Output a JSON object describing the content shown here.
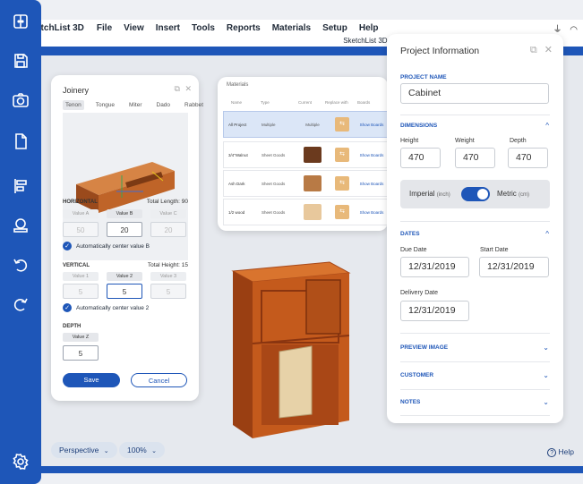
{
  "menubar": {
    "app_name": "etchList 3D",
    "items": [
      "File",
      "View",
      "Insert",
      "Tools",
      "Reports",
      "Materials",
      "Setup",
      "Help"
    ],
    "window_title": "SketchList 3D Li"
  },
  "sidebar": {
    "icons": [
      "layout-icon",
      "save-icon",
      "camera-icon",
      "copy-icon",
      "align-icon",
      "wrap-icon",
      "undo-icon",
      "redo-icon",
      "settings-icon"
    ]
  },
  "joinery": {
    "title": "Joinery",
    "tabs": [
      "Tenon",
      "Tongue",
      "Miter",
      "Dado",
      "Rabbet"
    ],
    "horizontal_label": "HORIZONTAL",
    "horizontal_total": "Total Length: 90",
    "horizontal_value_labels": [
      "Value A",
      "Value B",
      "Value C"
    ],
    "horizontal_values": [
      "50",
      "20",
      "20"
    ],
    "auto_center_h": "Automatically center value B",
    "vertical_label": "VERTICAL",
    "vertical_total": "Total Height: 15",
    "vertical_value_labels": [
      "Value 1",
      "Value 2",
      "Value 3"
    ],
    "vertical_values": [
      "5",
      "5",
      "5"
    ],
    "auto_center_v": "Automatically center value 2",
    "depth_label": "DEPTH",
    "depth_value_label": "Value Z",
    "depth_value": "5",
    "save": "Save",
    "cancel": "Cancel"
  },
  "materials": {
    "title": "Materials",
    "headers": [
      "Name",
      "Type",
      "Current",
      "Replace with",
      "Boards"
    ],
    "rows": [
      {
        "name": "All Project",
        "type": "Multiple",
        "current": "Multiple",
        "boards": "Show Boards",
        "swatch": "",
        "selected": true
      },
      {
        "name": "3/4\"Walnut",
        "type": "Sheet Goods",
        "current": "",
        "boards": "Show Boards",
        "swatch": "#6b3a1e",
        "selected": false
      },
      {
        "name": "Ash Dark",
        "type": "Sheet Goods",
        "current": "",
        "boards": "Show Boards",
        "swatch": "#b87a45",
        "selected": false
      },
      {
        "name": "1/2 wood",
        "type": "Sheet Goods",
        "current": "",
        "boards": "Show Boards",
        "swatch": "#e8c89c",
        "selected": false
      }
    ]
  },
  "project": {
    "title": "Project Information",
    "project_name_label": "PROJECT NAME",
    "project_name": "Cabinet",
    "dimensions_label": "DIMENSIONS",
    "height_label": "Height",
    "height": "470",
    "weight_label": "Weight",
    "weight": "470",
    "depth_label": "Depth",
    "depth": "470",
    "imperial": "Imperial",
    "imperial_unit": "(inch)",
    "metric": "Metric",
    "metric_unit": "(cm)",
    "dates_label": "DATES",
    "due_date_label": "Due Date",
    "due_date": "12/31/2019",
    "start_date_label": "Start Date",
    "start_date": "12/31/2019",
    "delivery_date_label": "Delivery Date",
    "delivery_date": "12/31/2019",
    "preview_label": "PREVIEW IMAGE",
    "customer_label": "CUSTOMER",
    "notes_label": "NOTES"
  },
  "viewport": {
    "view_mode": "Perspective",
    "zoom": "100%",
    "help": "Help"
  },
  "colors": {
    "accent": "#1e56b8",
    "wood": "#c45a1c"
  }
}
